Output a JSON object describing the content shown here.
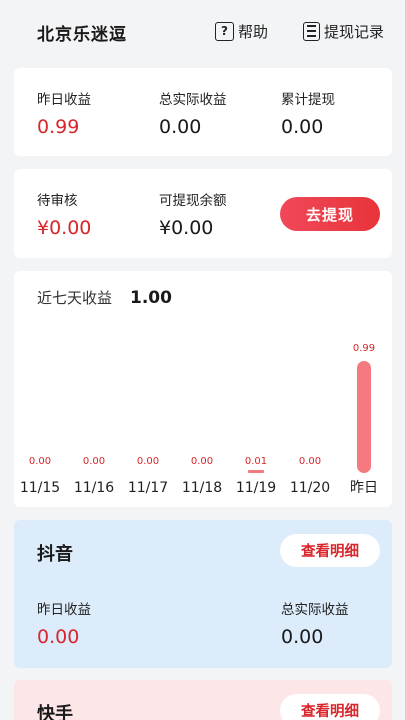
{
  "header": {
    "title": "北京乐迷逗",
    "help_label": "帮助",
    "records_label": "提现记录"
  },
  "summary": {
    "yesterday_label": "昨日收益",
    "yesterday_value": "0.99",
    "total_label": "总实际收益",
    "total_value": "0.00",
    "cumulative_label": "累计提现",
    "cumulative_value": "0.00"
  },
  "balance": {
    "pending_label": "待审核",
    "pending_value": "¥0.00",
    "available_label": "可提现余额",
    "available_value": "¥0.00",
    "withdraw_label": "去提现"
  },
  "weekly": {
    "title": "近七天收益",
    "total": "1.00"
  },
  "chart_data": {
    "type": "bar",
    "categories": [
      "11/15",
      "11/16",
      "11/17",
      "11/18",
      "11/19",
      "11/20",
      "昨日"
    ],
    "values": [
      0.0,
      0.0,
      0.0,
      0.0,
      0.01,
      0.0,
      0.99
    ],
    "value_labels": [
      "0.00",
      "0.00",
      "0.00",
      "0.00",
      "0.01",
      "0.00",
      "0.99"
    ],
    "bar_color": "#f47a80",
    "label_color": "#d8262b"
  },
  "platforms": [
    {
      "name": "抖音",
      "detail_label": "查看明细",
      "yesterday_label": "昨日收益",
      "yesterday_value": "0.00",
      "total_label": "总实际收益",
      "total_value": "0.00",
      "bg": "#dcecfb"
    },
    {
      "name": "快手",
      "detail_label": "查看明细",
      "bg": "#fde6e8"
    }
  ]
}
